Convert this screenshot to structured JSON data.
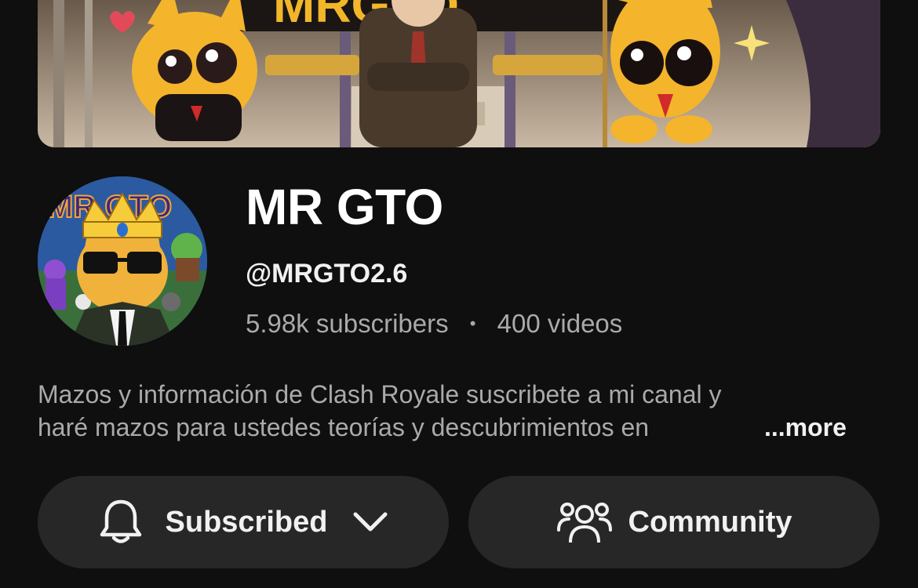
{
  "banner": {
    "icon": "channel-banner-art"
  },
  "channel": {
    "avatar_icon": "channel-avatar",
    "avatar_text": "MR.GTO",
    "name": "MR GTO",
    "handle": "@MRGTO2.6",
    "subscribers": "5.98k subscribers",
    "separator": "•",
    "videos": "400 videos"
  },
  "description": {
    "line1": "Mazos y información de Clash Royale suscribete a mi canal y",
    "line2": "haré mazos para ustedes teorías y descubrimientos en",
    "more_label": "...more"
  },
  "actions": {
    "subscribe_label": "Subscribed",
    "subscribe_icon": "bell-icon",
    "dropdown_icon": "chevron-down-icon",
    "community_label": "Community",
    "community_icon": "people-icon"
  },
  "colors": {
    "background": "#0f0f0f",
    "button_bg": "#272727",
    "text_primary": "#f1f1f1",
    "text_secondary": "#aaaaaa"
  }
}
